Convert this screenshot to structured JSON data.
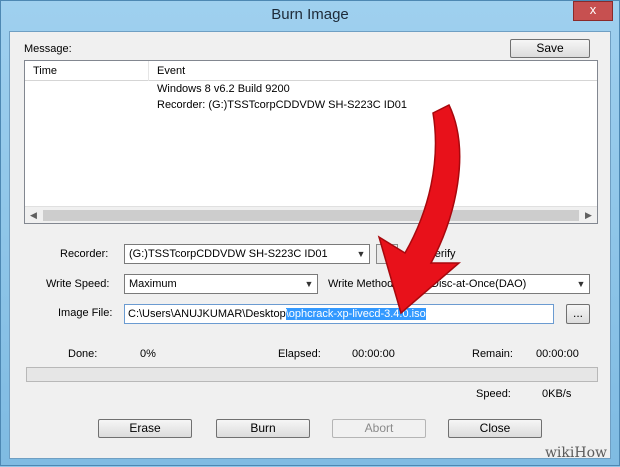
{
  "window": {
    "title": "Burn Image",
    "close_label": "x"
  },
  "message": {
    "label": "Message:",
    "save_label": "Save",
    "columns": [
      "Time",
      "Event"
    ],
    "rows": [
      {
        "time": "",
        "event": "Windows 8 v6.2 Build 9200"
      },
      {
        "time": "",
        "event": "Recorder: (G:)TSSTcorpCDDVDW SH-S223C ID01"
      }
    ]
  },
  "recorder": {
    "label": "Recorder:",
    "value": "(G:)TSSTcorpCDDVDW SH-S223C ID01",
    "verify_label": "Verify"
  },
  "write_speed": {
    "label": "Write Speed:",
    "value": "Maximum"
  },
  "write_method": {
    "label": "Write Method:",
    "value": "Disc-at-Once(DAO)"
  },
  "image_file": {
    "label": "Image File:",
    "path_prefix": "C:\\Users\\ANUJKUMAR\\Desktop",
    "path_selected": "\\ophcrack-xp-livecd-3.4.0.iso",
    "browse_label": "..."
  },
  "status": {
    "done_label": "Done:",
    "done_value": "0%",
    "elapsed_label": "Elapsed:",
    "elapsed_value": "00:00:00",
    "remain_label": "Remain:",
    "remain_value": "00:00:00",
    "speed_label": "Speed:",
    "speed_value": "0KB/s",
    "progress": 0
  },
  "buttons": {
    "erase": "Erase",
    "burn": "Burn",
    "abort": "Abort",
    "close": "Close"
  },
  "watermark": "wikiHow",
  "colors": {
    "arrow": "#e8111a",
    "selection": "#3399ff"
  }
}
